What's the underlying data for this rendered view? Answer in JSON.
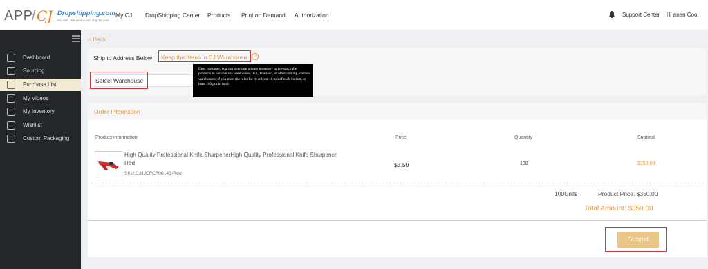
{
  "header": {
    "logo_app": "APP",
    "logo_sep": "/",
    "logo_cj": "CJ",
    "logo_brand": "Dropshipping.com",
    "logo_tagline": "You sell · We source and ship for you!",
    "nav": [
      "My CJ",
      "DropShipping Center",
      "Products",
      "Print on Demand",
      "Authorization"
    ],
    "support": "Support Center",
    "user": "Hi anan Coo."
  },
  "sidebar": {
    "items": [
      {
        "label": "Dashboard",
        "icon": "dashboard-icon"
      },
      {
        "label": "Sourcing",
        "icon": "sourcing-icon"
      },
      {
        "label": "Purchase List",
        "icon": "purchase-list-icon"
      },
      {
        "label": "My Videos",
        "icon": "video-icon"
      },
      {
        "label": "My Inventory",
        "icon": "inventory-icon"
      },
      {
        "label": "Wishlist",
        "icon": "wishlist-icon"
      },
      {
        "label": "Custom Packaging",
        "icon": "gift-icon"
      }
    ]
  },
  "page": {
    "back": "< Back",
    "ship_label": "Ship to Address Below",
    "keep_label": "Keep the Items in CJ Warehouse",
    "help_icon": "?",
    "select_label": "Select Warehouse",
    "tooltip": "Dear customer, you can purchase private inventory to pre-stock the products in our oversea warehouses (US, Thailand, or other coming oversea warehouses) if you meet the rules for it: at least 10 pcs of each variant, at least 100 pcs in total."
  },
  "order": {
    "title": "Order Information",
    "columns": [
      "Product information",
      "Price",
      "Quantity",
      "Subtotal"
    ],
    "product_name": "High Quality Professional Knife SharpenerHigh Quality Professional Knife Sharpener Red",
    "sku": "SKU:CJJJCFCF00143-Red",
    "price": "$3.50",
    "quantity": "100",
    "subtotal": "$350.00",
    "units": "100Units",
    "product_price": "Product Price: $350.00",
    "total": "Total Amount: $350.00",
    "submit": "Submit"
  },
  "colors": {
    "accent": "#e6953a",
    "highlight_box": "#d9343a",
    "sidebar_bg": "#24272a",
    "submit_bg": "#e8c788"
  }
}
